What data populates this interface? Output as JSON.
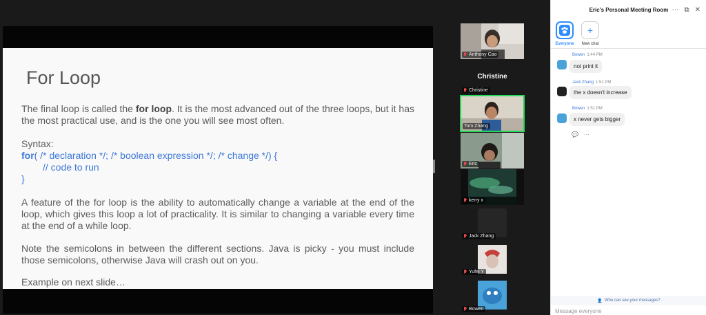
{
  "slide": {
    "title": "For Loop",
    "intro_1": "The final loop is called the ",
    "intro_bold": "for loop",
    "intro_2": ".  It is the most advanced out of the three loops, but it has the most practical use, and is the one you will see most often.",
    "syntax_label": "Syntax:",
    "code_keyword": "for",
    "code_line1_rest": "( /* declaration */; /* boolean expression */; /* change */) {",
    "code_line2": "// code to run",
    "code_line3": "}",
    "para2": "A feature of the for loop is the ability to automatically change a variable at the end of the loop, which gives this loop a lot of practicality. It is similar to changing a variable every time at the end of a while loop.",
    "para3": "Note the semicolons in between the different sections.  Java is picky - you must include those semicolons, otherwise Java will crash out on you.",
    "para4": "Example on next slide…"
  },
  "participants": [
    {
      "name": "Anthony Cao",
      "muted": true
    },
    {
      "name": "Christine",
      "muted": true,
      "display_name": "Christine"
    },
    {
      "name": "Tom Zhang",
      "muted": false,
      "active_speaker": true
    },
    {
      "name": "Eric",
      "muted": true
    },
    {
      "name": "kerry x",
      "muted": true
    },
    {
      "name": "Jack Zhang",
      "muted": true
    },
    {
      "name": "Yufei Y",
      "muted": true
    },
    {
      "name": "Bowen",
      "muted": true
    }
  ],
  "chat": {
    "title": "Eric's Personal Meeting Room",
    "tabs": {
      "everyone": "Everyone",
      "new_chat": "New chat"
    },
    "messages": [
      {
        "sender": "Bowen",
        "time": "1:44 PM",
        "text": "not print it"
      },
      {
        "sender": "Jack Zhang",
        "time": "1:51 PM",
        "text": "the x doesn't increase"
      },
      {
        "sender": "Bowen",
        "time": "1:51 PM",
        "text": "x never gets bigger"
      }
    ],
    "visibility_note": "Who can see your messages?",
    "placeholder": "Message everyone"
  },
  "colors": {
    "accent": "#2d8cff",
    "code_blue": "#3d78d8",
    "active_border": "#23d959",
    "muted_red": "#e14b4b"
  }
}
